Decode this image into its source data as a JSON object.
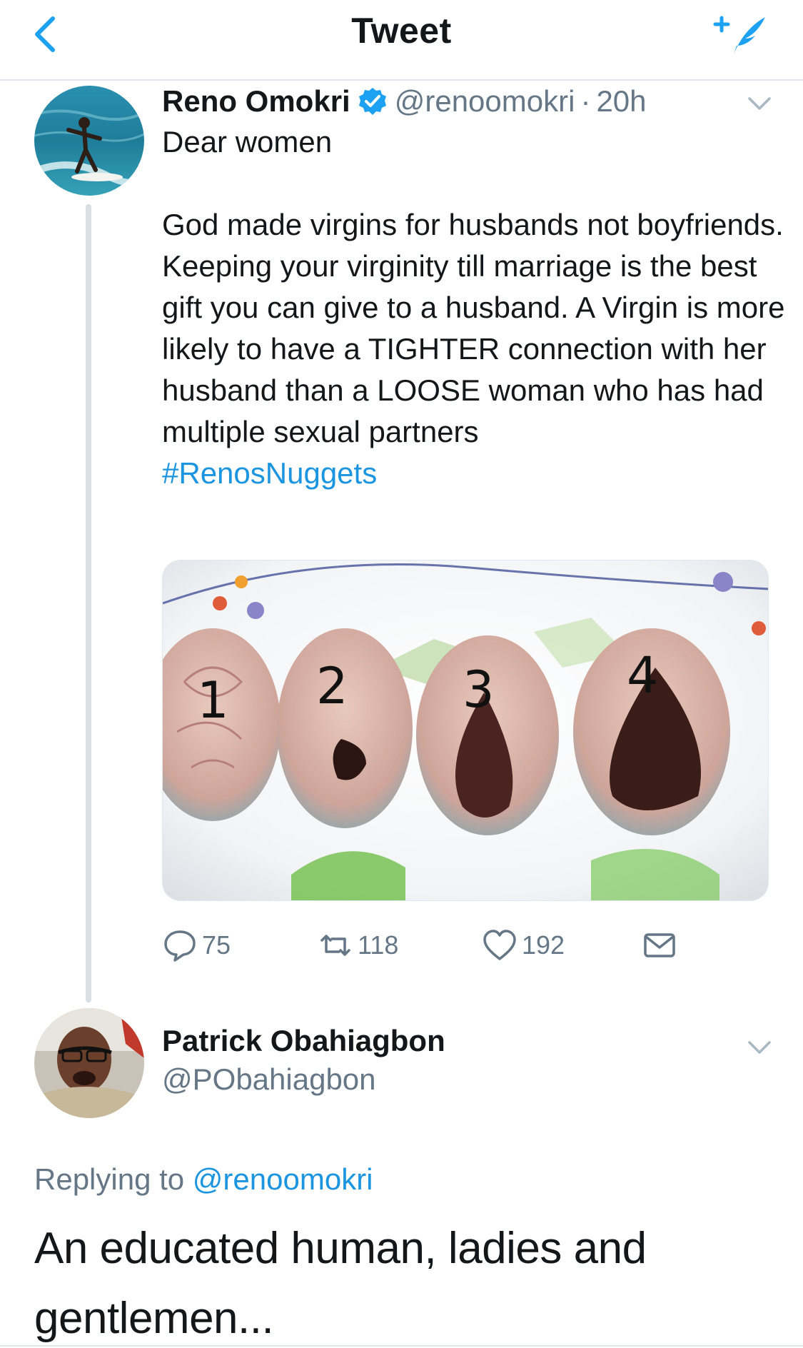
{
  "header": {
    "title": "Tweet",
    "back_icon": "chevron-left-icon",
    "compose_icon": "compose-feather-icon",
    "accent_color": "#1da1f2"
  },
  "tweet": {
    "display_name": "Reno Omokri",
    "verified": true,
    "handle": "@renoomokri",
    "separator": "·",
    "time": "20h",
    "text_line_1": "Dear women",
    "text_paragraph_2": "God made virgins for husbands not boyfriends. Keeping your virginity till marriage is the best gift you can give to a husband. A Virgin is more likely to have a TIGHTER connection with her husband than a LOOSE woman who has had multiple sexual partners",
    "hashtag": "#RenosNuggets",
    "media_labels": [
      "1",
      "2",
      "3",
      "4"
    ],
    "actions": {
      "replies": "75",
      "retweets": "118",
      "likes": "192"
    }
  },
  "reply": {
    "display_name": "Patrick Obahiagbon",
    "handle": "@PObahiagbon",
    "replying_prefix": "Replying to ",
    "replying_to": "@renoomokri",
    "text": "An educated human, ladies and gentlemen..."
  },
  "colors": {
    "link": "#1b95e0",
    "secondary_text": "#657786",
    "divider": "#e1e8ed"
  }
}
